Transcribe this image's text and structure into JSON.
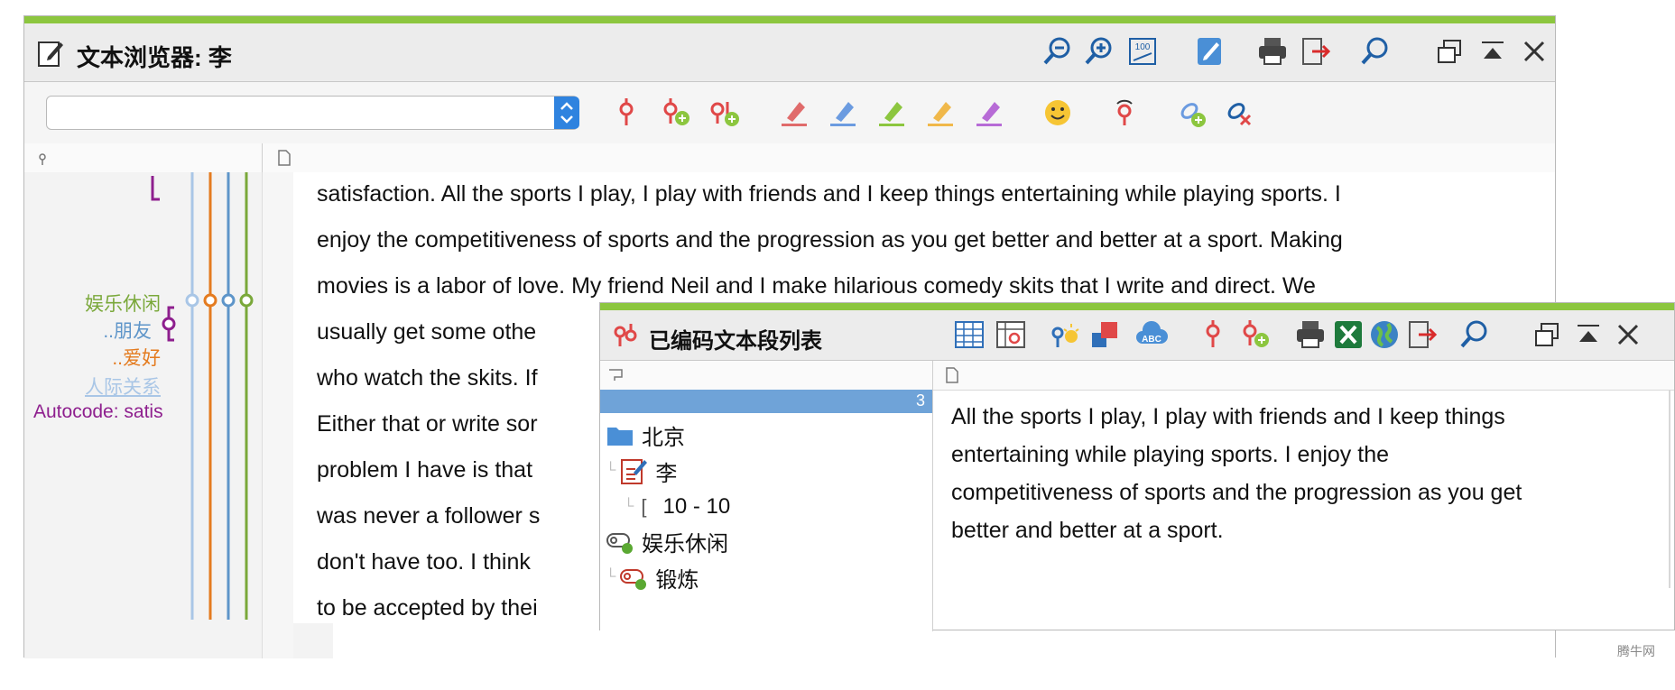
{
  "main_window": {
    "title": "文本浏览器: 李",
    "search_value": "",
    "doc_lines": [
      "satisfaction. All the sports I play, I play with friends and I keep things entertaining while playing sports. I",
      "enjoy the competitiveness of sports and the progression as you get better and better at a sport. Making",
      "movies is a labor of love. My friend Neil and I make hilarious comedy skits that I write and direct. We",
      "usually get some othe",
      "who watch the skits. If",
      "Either that or write sor",
      "problem I have is that",
      "was never a follower s",
      "don't have too. I think",
      "to be accepted by thei"
    ],
    "codes": [
      {
        "label": "娱乐休闲",
        "color": "#7aa83a"
      },
      {
        "label": "..朋友",
        "color": "#5e95c9"
      },
      {
        "label": "..爱好",
        "color": "#e47b1f"
      },
      {
        "label": "人际关系",
        "color": "#a9c6e6"
      },
      {
        "label": "Autocode: satis",
        "color": "#8e1f8e"
      }
    ]
  },
  "popup": {
    "title": "已编码文本段列表",
    "count": "3",
    "tree": [
      {
        "label": "北京",
        "icon": "folder-icon"
      },
      {
        "label": "李",
        "icon": "document-icon"
      },
      {
        "label": "10 - 10",
        "icon": "segment-bracket-icon"
      },
      {
        "label": "娱乐休闲",
        "icon": "code-icon"
      },
      {
        "label": "锻炼",
        "icon": "code-icon"
      }
    ],
    "text_lines": [
      "All the sports I play, I play with friends and I keep things",
      "entertaining while playing sports. I enjoy the",
      "competitiveness of sports and the progression as you get",
      "better and better at a sport."
    ]
  },
  "watermark": "腾牛网",
  "colors": {
    "accent": "#8cc63f",
    "selection": "#6fa3d8",
    "combo_button": "#2f83df"
  }
}
